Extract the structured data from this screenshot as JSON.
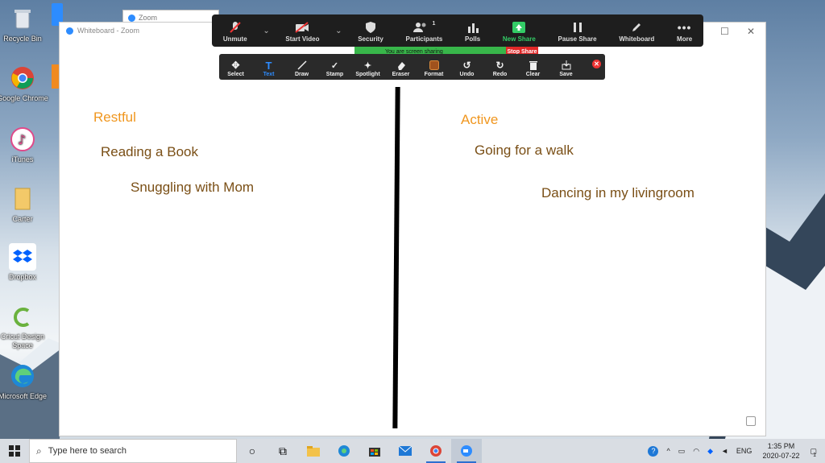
{
  "desktop": {
    "icons": [
      {
        "label": "Recycle Bin"
      },
      {
        "label": "Google Chrome"
      },
      {
        "label": "iTunes"
      },
      {
        "label": "Carter"
      },
      {
        "label": "Dropbox"
      },
      {
        "label": "Cricut Design Space"
      },
      {
        "label": "Microsoft Edge"
      }
    ]
  },
  "bg_window": {
    "title": "Zoom"
  },
  "whiteboard": {
    "title": "Whiteboard - Zoom",
    "left_heading": "Restful",
    "left_items": [
      "Reading a Book",
      "Snuggling with Mom"
    ],
    "right_heading": "Active",
    "right_items": [
      "Going for a walk",
      "Dancing in my livingroom"
    ],
    "colors": {
      "heading": "#f0961e",
      "item": "#7a4f16"
    }
  },
  "zoom_toolbar": {
    "buttons": [
      {
        "label": "Unmute",
        "icon": "microphone-muted-icon"
      },
      {
        "label": "Start Video",
        "icon": "video-off-icon"
      },
      {
        "label": "Security",
        "icon": "shield-icon"
      },
      {
        "label": "Participants",
        "icon": "participants-icon",
        "count": "1"
      },
      {
        "label": "Polls",
        "icon": "polls-icon"
      },
      {
        "label": "New Share",
        "icon": "share-up-icon"
      },
      {
        "label": "Pause Share",
        "icon": "pause-icon"
      },
      {
        "label": "Whiteboard",
        "icon": "pen-icon"
      },
      {
        "label": "More",
        "icon": "more-icon"
      }
    ],
    "banner": "You are screen sharing",
    "stop_share": "Stop Share"
  },
  "annotation_toolbar": {
    "buttons": [
      {
        "label": "Select",
        "icon": "move-icon"
      },
      {
        "label": "Text",
        "icon": "text-icon",
        "active": true
      },
      {
        "label": "Draw",
        "icon": "draw-icon"
      },
      {
        "label": "Stamp",
        "icon": "stamp-check-icon"
      },
      {
        "label": "Spotlight",
        "icon": "spotlight-icon"
      },
      {
        "label": "Eraser",
        "icon": "eraser-icon"
      },
      {
        "label": "Format",
        "icon": "format-icon"
      },
      {
        "label": "Undo",
        "icon": "undo-icon"
      },
      {
        "label": "Redo",
        "icon": "redo-icon"
      },
      {
        "label": "Clear",
        "icon": "trash-icon"
      },
      {
        "label": "Save",
        "icon": "save-icon"
      }
    ]
  },
  "taskbar": {
    "search_placeholder": "Type here to search",
    "tray_lang": "ENG",
    "time": "1:35 PM",
    "date": "2020-07-22",
    "notification_count": "1"
  }
}
